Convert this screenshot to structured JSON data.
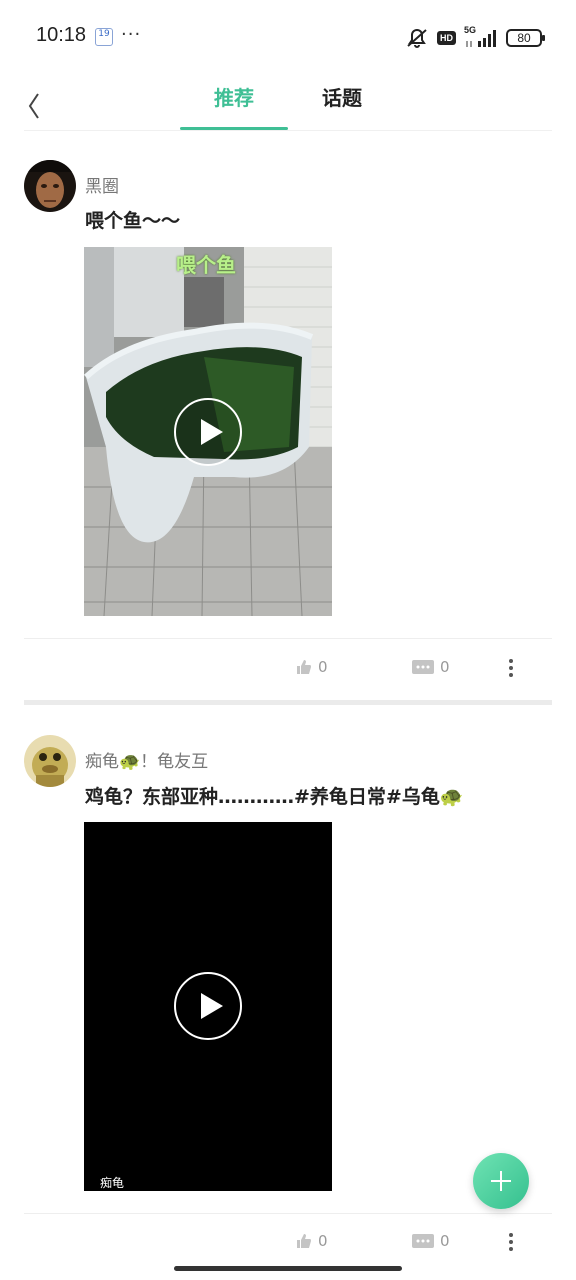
{
  "status_bar": {
    "time": "10:18",
    "calendar_day": "19",
    "dots": "···",
    "network": "5G",
    "hd": "HD",
    "battery": "80"
  },
  "nav": {
    "tabs": [
      {
        "label": "推荐",
        "active": true
      },
      {
        "label": "话题",
        "active": false
      }
    ],
    "accent_color": "#3fbf95"
  },
  "posts": [
    {
      "author": "黑圈",
      "title": "喂个鱼～～",
      "video_caption": "喂个鱼",
      "likes": "0",
      "comments": "0"
    },
    {
      "author": "痴龟🐢！龟友互",
      "title": "鸡龟？东部亚种…………#养龟日常#乌龟🐢",
      "video_watermark": "痴龟",
      "likes": "0",
      "comments": "0"
    }
  ],
  "fab": {
    "icon": "plus-icon"
  }
}
